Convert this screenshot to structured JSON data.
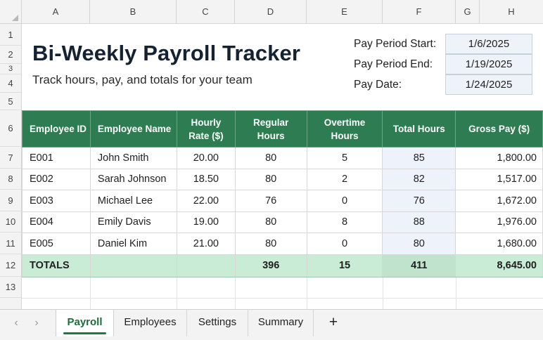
{
  "columns": [
    "A",
    "B",
    "C",
    "D",
    "E",
    "F",
    "G",
    "H"
  ],
  "rows": [
    "1",
    "2",
    "3",
    "4",
    "5",
    "6",
    "7",
    "8",
    "9",
    "10",
    "11",
    "12",
    "13"
  ],
  "title": "Bi-Weekly Payroll Tracker",
  "subtitle": "Track hours, pay, and totals for your team",
  "pay_period": {
    "start_label": "Pay Period Start:",
    "start_value": "1/6/2025",
    "end_label": "Pay Period End:",
    "end_value": "1/19/2025",
    "date_label": "Pay Date:",
    "date_value": "1/24/2025"
  },
  "table": {
    "headers": [
      "Employee ID",
      "Employee Name",
      "Hourly Rate ($)",
      "Regular Hours",
      "Overtime Hours",
      "Total Hours",
      "Gross Pay ($)"
    ],
    "rows": [
      [
        "E001",
        "John Smith",
        "20.00",
        "80",
        "5",
        "85",
        "1,800.00"
      ],
      [
        "E002",
        "Sarah Johnson",
        "18.50",
        "80",
        "2",
        "82",
        "1,517.00"
      ],
      [
        "E003",
        "Michael Lee",
        "22.00",
        "76",
        "0",
        "76",
        "1,672.00"
      ],
      [
        "E004",
        "Emily Davis",
        "19.00",
        "80",
        "8",
        "88",
        "1,976.00"
      ],
      [
        "E005",
        "Daniel Kim",
        "21.00",
        "80",
        "0",
        "80",
        "1,680.00"
      ]
    ],
    "totals": {
      "label": "TOTALS",
      "regular": "396",
      "overtime": "15",
      "total_hours": "411",
      "gross_pay": "8,645.00"
    }
  },
  "tabs": [
    "Payroll",
    "Employees",
    "Settings",
    "Summary"
  ],
  "active_tab": "Payroll",
  "add_tab_label": "+",
  "nav": {
    "prev": "‹",
    "next": "›"
  },
  "colors": {
    "header_green": "#2e7d52",
    "totals_green": "#c9ecd6",
    "highlight_blue": "#eef3fb",
    "title_navy": "#142232"
  }
}
